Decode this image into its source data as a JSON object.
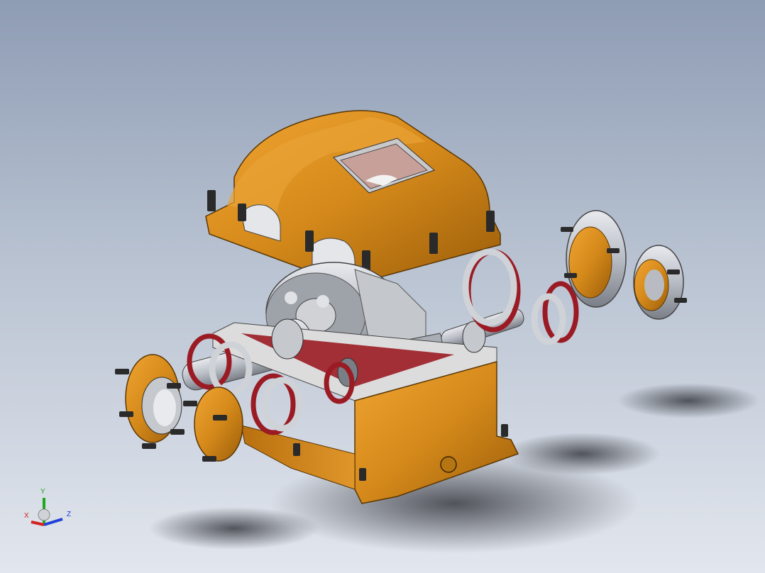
{
  "viewport": {
    "background_top": "#8e9cb4",
    "background_bottom": "#e2e6ee",
    "part_color": "#d08a18",
    "gasket_color": "#9b1b24",
    "steel_color": "#b9bcc2"
  },
  "triad": {
    "x_label": "X",
    "y_label": "Y",
    "z_label": "Z",
    "x_color": "#d42020",
    "y_color": "#1fa81f",
    "z_color": "#2040d8"
  }
}
